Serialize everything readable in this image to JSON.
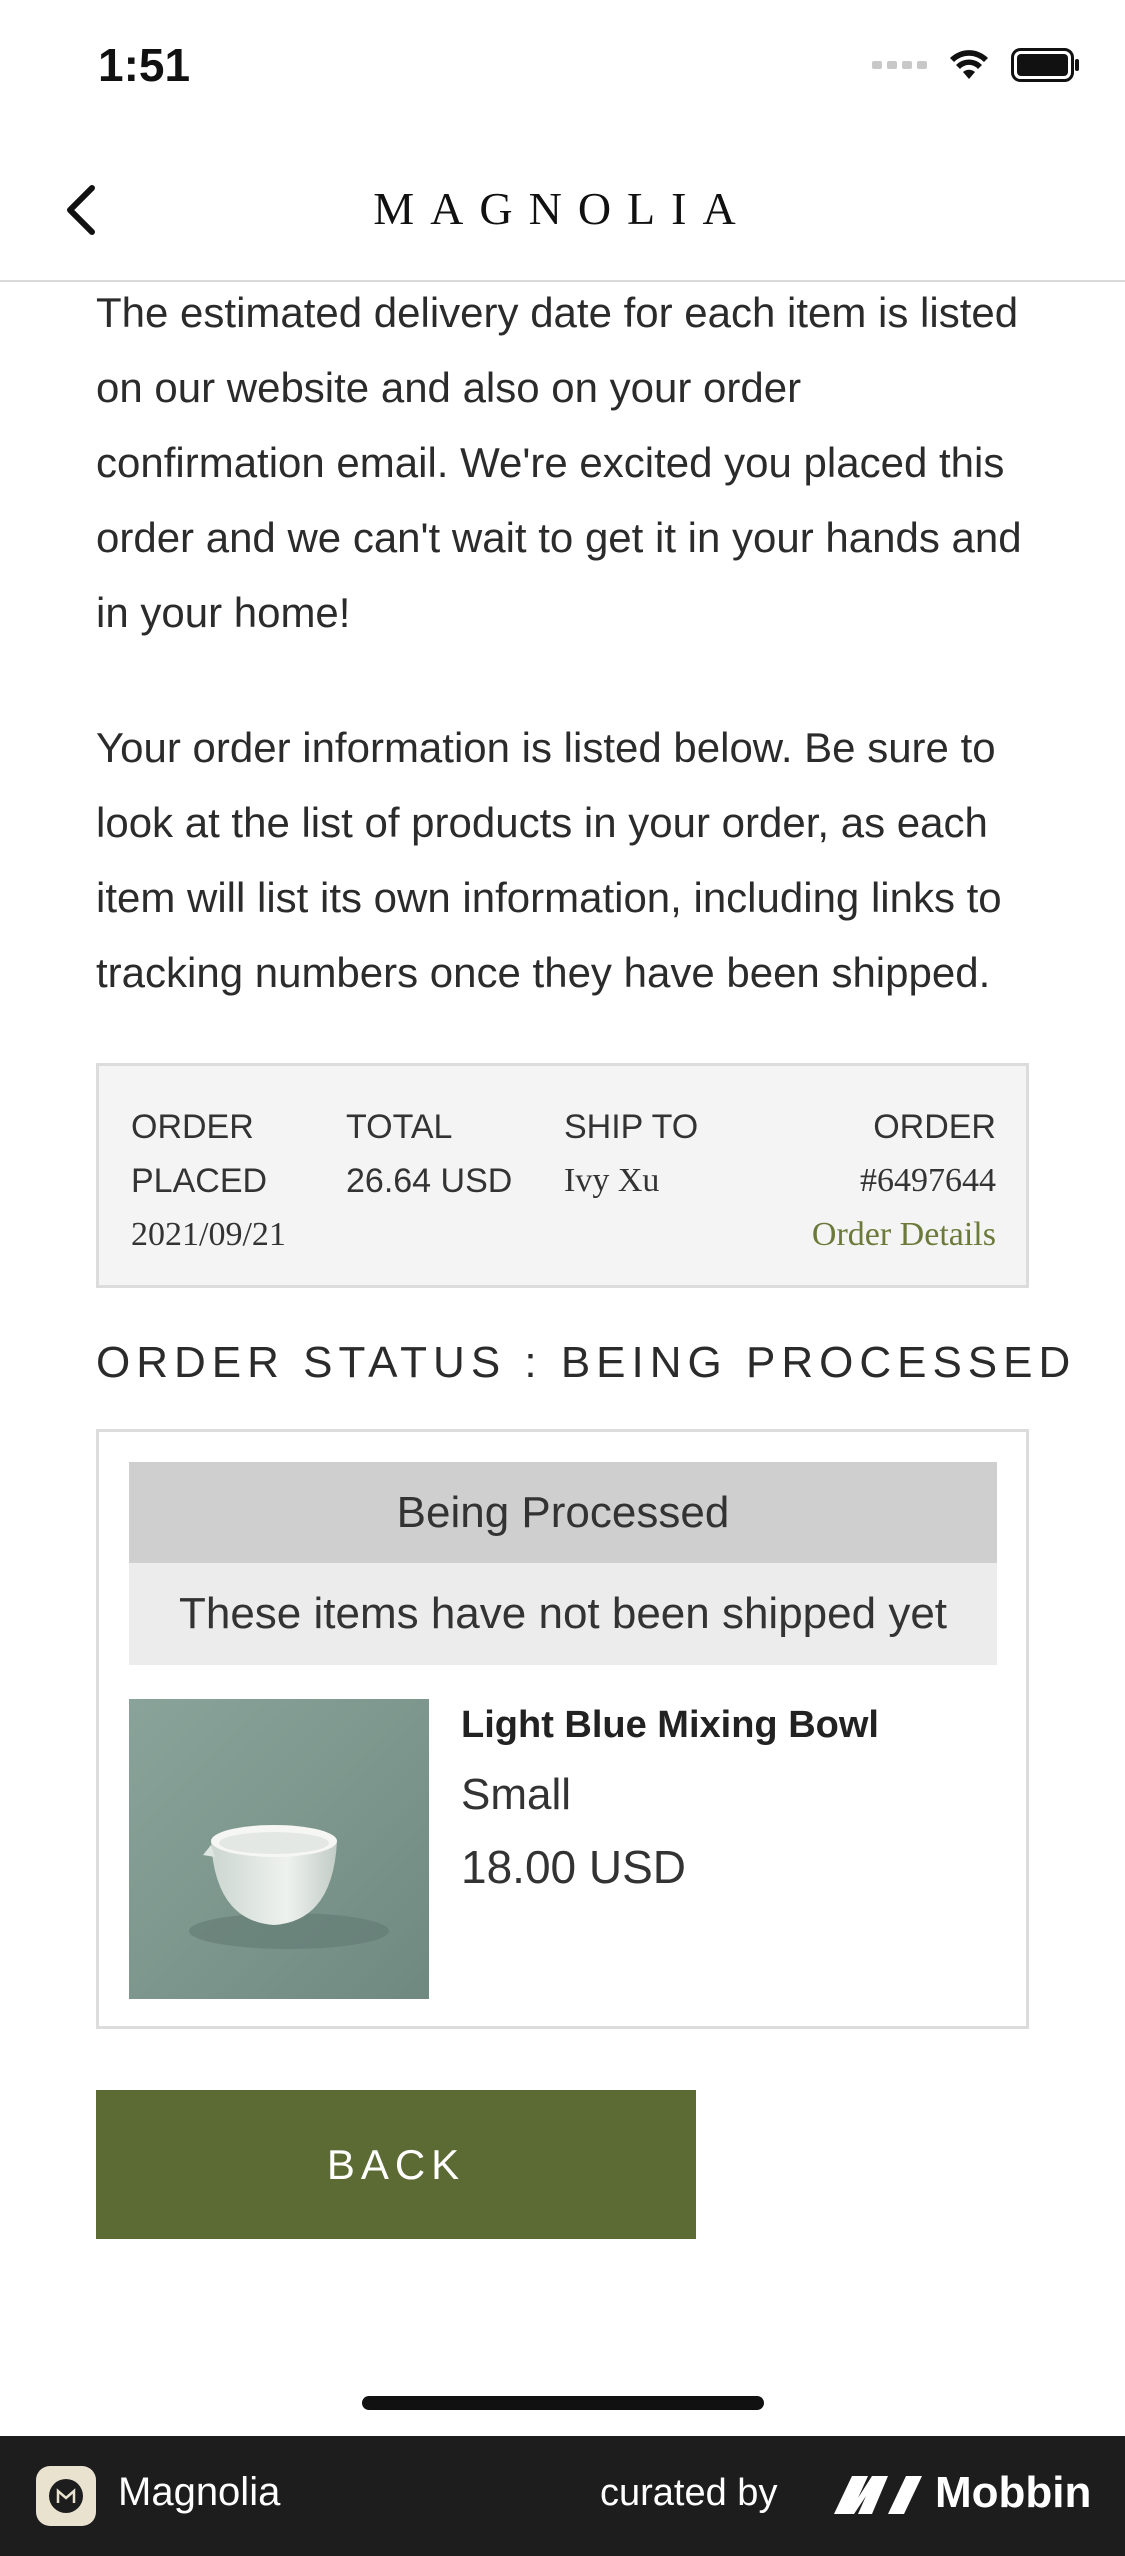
{
  "status_bar": {
    "time": "1:51"
  },
  "header": {
    "brand": "MAGNOLIA"
  },
  "intro": {
    "paragraph1": "The estimated delivery date for each item is listed on our website and also on your order confirmation email. We're excited you placed this order and we can't wait to get it in your hands and in your home!",
    "paragraph2": "Your order information is listed below. Be sure to look at the list of products in your order, as each item will list its own information, including links to tracking numbers once they have been shipped."
  },
  "order_summary": {
    "placed_label_line1": "ORDER",
    "placed_label_line2": "PLACED",
    "placed_date": "2021/09/21",
    "total_label": "TOTAL",
    "total_value": "26.64 USD",
    "ship_to_label": "SHIP TO",
    "ship_to_value": "Ivy Xu",
    "order_label": "ORDER",
    "order_number": "#6497644",
    "order_details_link": "Order Details"
  },
  "order_status": {
    "heading": "ORDER STATUS : BEING PROCESSED",
    "stage": "Being Processed",
    "stage_note": "These items have not been shipped yet"
  },
  "product": {
    "name": "Light Blue Mixing Bowl",
    "variant": "Small",
    "price": "18.00 USD"
  },
  "actions": {
    "back_label": "BACK"
  },
  "footer": {
    "app_name": "Magnolia",
    "curated_by": "curated by",
    "brand": "Mobbin"
  }
}
